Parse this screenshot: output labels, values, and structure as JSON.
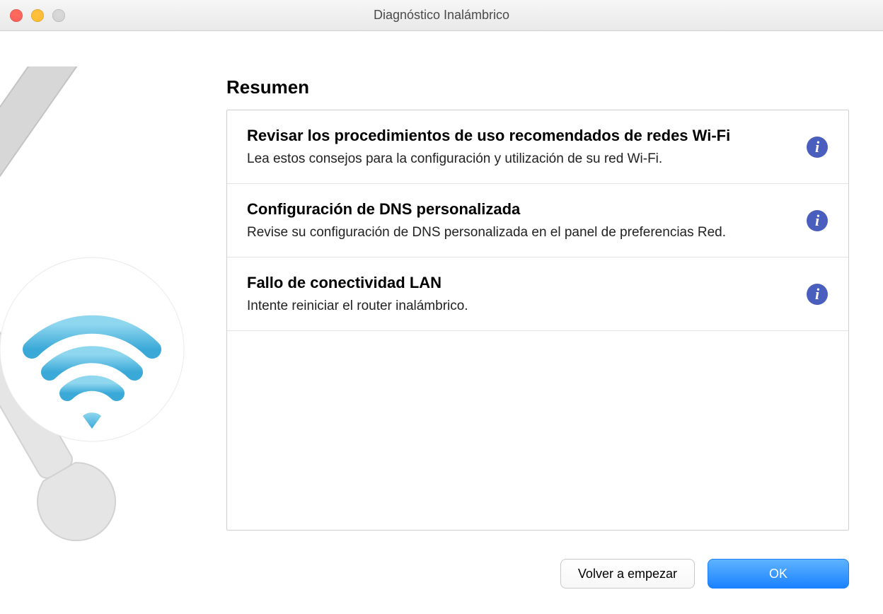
{
  "window": {
    "title": "Diagnóstico Inalámbrico"
  },
  "main": {
    "heading": "Resumen",
    "items": [
      {
        "title": "Revisar los procedimientos de uso recomendados de redes Wi-Fi",
        "desc": "Lea estos consejos para la configuración y utilización de su red Wi-Fi."
      },
      {
        "title": "Configuración de DNS personalizada",
        "desc": "Revise su configuración de DNS personalizada en el panel de preferencias Red."
      },
      {
        "title": "Fallo de conectividad LAN",
        "desc": "Intente reiniciar el router inalámbrico."
      }
    ]
  },
  "buttons": {
    "secondary": "Volver a empezar",
    "primary": "OK"
  },
  "colors": {
    "info_icon": "#4a5fbd"
  }
}
